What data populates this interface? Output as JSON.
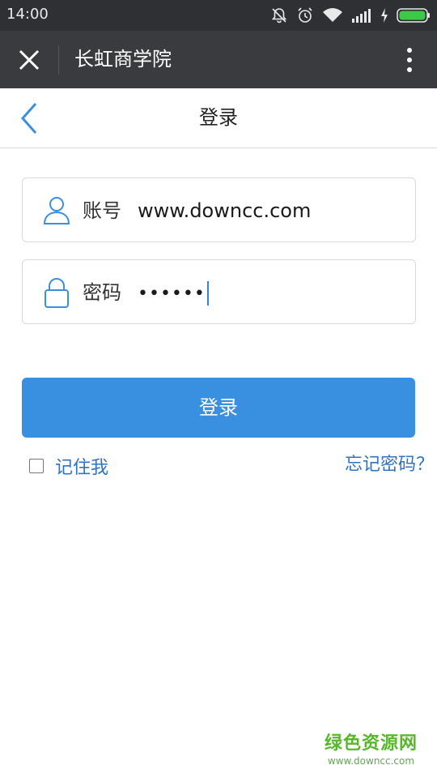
{
  "status_bar": {
    "time": "14:00",
    "icons": [
      "bell-muted-icon",
      "alarm-icon",
      "wifi-icon",
      "signal-icon",
      "charging-icon",
      "battery-icon"
    ],
    "battery_color": "#3ec84a"
  },
  "app_bar": {
    "title": "长虹商学院",
    "icons": [
      "close-icon",
      "more-vertical-icon"
    ]
  },
  "page_header": {
    "title": "登录",
    "icons": [
      "back-chevron-icon"
    ]
  },
  "form": {
    "account": {
      "label": "账号",
      "value": "www.downcc.com",
      "icon": "user-icon"
    },
    "password": {
      "label": "密码",
      "value": "••••••",
      "icon": "lock-icon"
    },
    "login_button": "登录",
    "remember_me": "记住我",
    "remember_checked": false,
    "forgot_password": "忘记密码？"
  },
  "watermark": {
    "text": "绿色资源网",
    "url": "www.downcc.com"
  },
  "colors": {
    "accent": "#3a90e0",
    "link": "#2f74c0",
    "app_bar": "#3a3b3f",
    "status_bar": "#2f3033",
    "watermark_green": "#58b82c"
  }
}
